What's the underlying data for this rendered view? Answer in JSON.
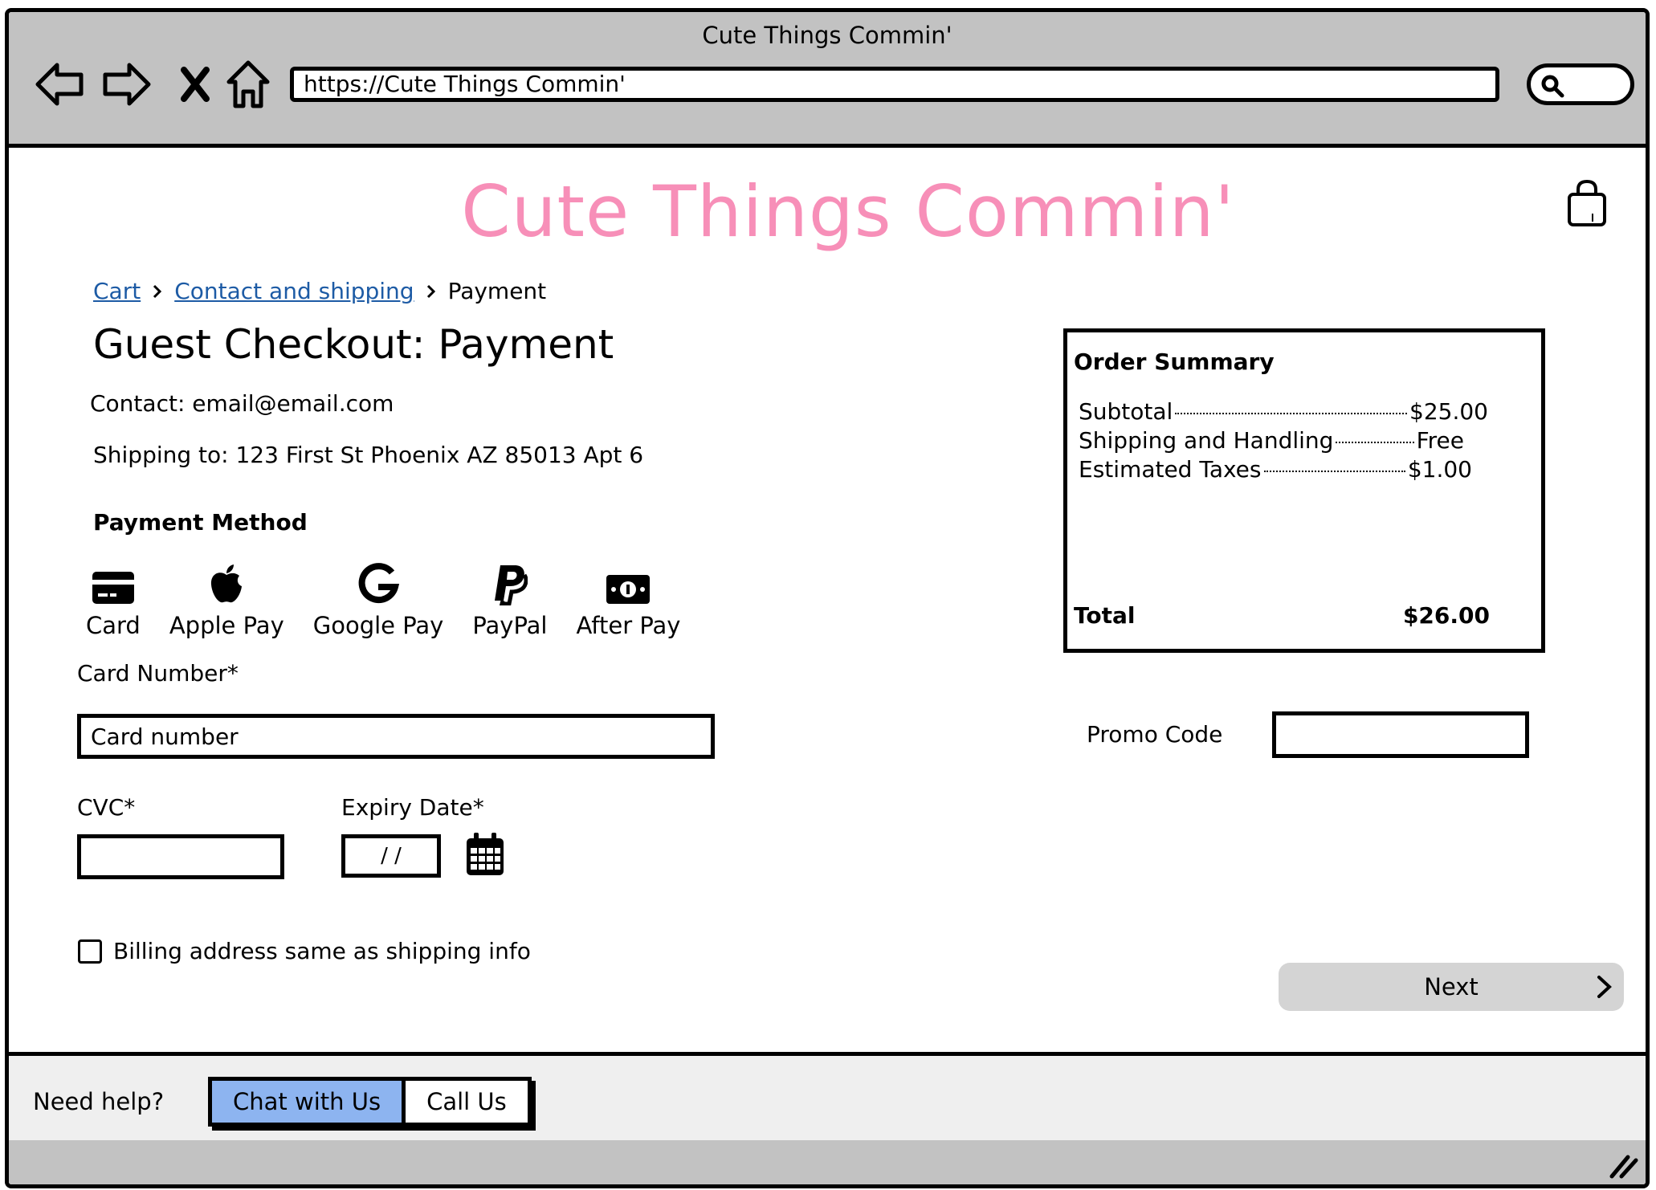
{
  "window": {
    "title": "Cute Things Commin'",
    "url": "https://Cute Things Commin'"
  },
  "colors": {
    "brand": "#f78fb8",
    "link": "#1d5ba5",
    "active_tab": "#8db4f0",
    "chrome": "#c2c2c2",
    "next_button": "#d4d4d4"
  },
  "header": {
    "brand": "Cute Things Commin'",
    "cart_icon": "shopping-bag-icon"
  },
  "breadcrumb": {
    "items": [
      {
        "label": "Cart",
        "link": true
      },
      {
        "label": "Contact and shipping",
        "link": true
      },
      {
        "label": "Payment",
        "link": false
      }
    ]
  },
  "checkout": {
    "title": "Guest Checkout: Payment",
    "contact": "Contact: email@email.com",
    "shipping": "Shipping to: 123 First St Phoenix AZ 85013 Apt 6"
  },
  "payment": {
    "heading": "Payment Method",
    "methods": [
      {
        "label": "Card",
        "icon": "credit-card-icon"
      },
      {
        "label": "Apple Pay",
        "icon": "apple-icon"
      },
      {
        "label": "Google Pay",
        "icon": "google-icon"
      },
      {
        "label": "PayPal",
        "icon": "paypal-icon"
      },
      {
        "label": "After Pay",
        "icon": "banknote-icon"
      }
    ]
  },
  "form": {
    "card_label": "Card Number*",
    "card_placeholder": "Card number",
    "cvc_label": "CVC*",
    "cvc_value": "",
    "expiry_label": "Expiry Date*",
    "expiry_value": "/ /",
    "calendar_icon": "calendar-icon",
    "billing_same": "Billing address same as shipping info",
    "billing_checked": false
  },
  "summary": {
    "title": "Order Summary",
    "rows": [
      {
        "label": "Subtotal",
        "value": "$25.00"
      },
      {
        "label": "Shipping and Handling",
        "value": "Free"
      },
      {
        "label": "Estimated Taxes",
        "value": "$1.00"
      }
    ],
    "total_label": "Total",
    "total_value": "$26.00"
  },
  "promo": {
    "label": "Promo Code",
    "value": ""
  },
  "actions": {
    "next": "Next"
  },
  "footer": {
    "need_help": "Need help?",
    "options": [
      "Chat with Us",
      "Call Us"
    ],
    "active": "Chat with Us"
  }
}
